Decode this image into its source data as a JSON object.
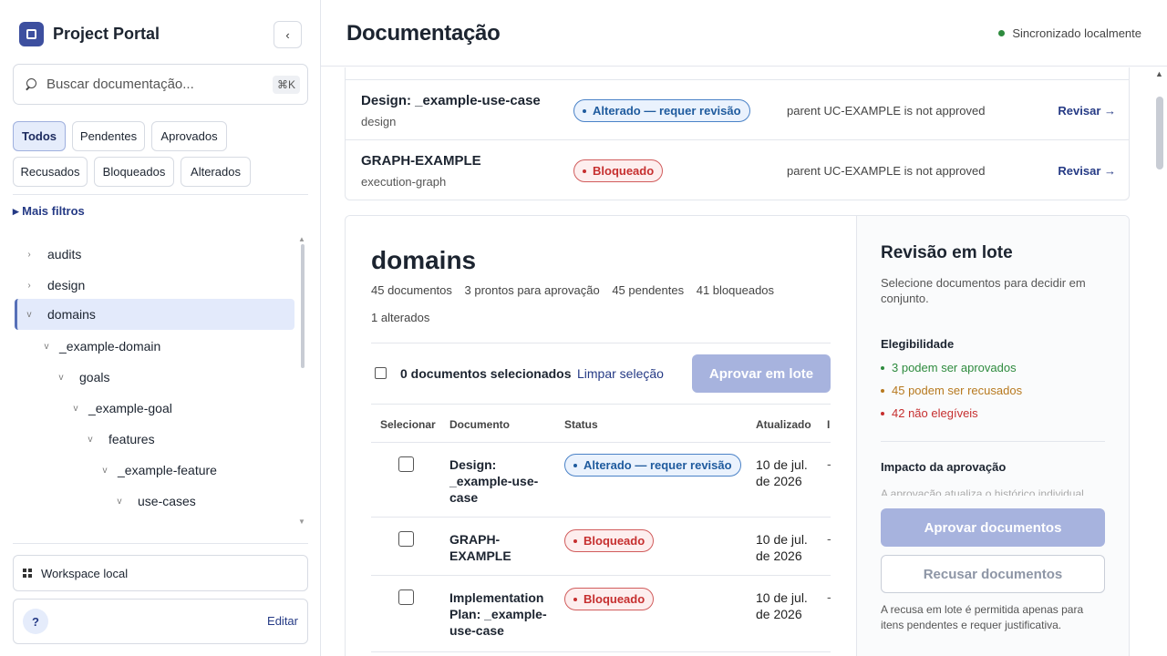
{
  "brand": {
    "title": "Project Portal",
    "collapse_icon": "‹"
  },
  "search": {
    "placeholder": "Buscar documentação...",
    "shortcut": "⌘K"
  },
  "filters": [
    {
      "label": "Todos",
      "active": true
    },
    {
      "label": "Pendentes"
    },
    {
      "label": "Aprovados"
    },
    {
      "label": "Recusados"
    },
    {
      "label": "Bloqueados"
    },
    {
      "label": "Alterados"
    }
  ],
  "more_filters": "▸ Mais filtros",
  "tree": [
    {
      "label": "audits",
      "chev": "›"
    },
    {
      "label": "design",
      "chev": "›"
    },
    {
      "label": "domains",
      "chev": "v",
      "selected": true
    },
    {
      "label": "_example-domain",
      "chev": "v"
    },
    {
      "label": "goals",
      "chev": "v"
    },
    {
      "label": "_example-goal",
      "chev": "v"
    },
    {
      "label": "features",
      "chev": "v"
    },
    {
      "label": "_example-feature",
      "chev": "v"
    },
    {
      "label": "use-cases",
      "chev": "v"
    }
  ],
  "workspace": "Workspace local",
  "help": {
    "icon": "?",
    "edit": "Editar"
  },
  "header": {
    "title": "Documentação",
    "sync": "Sincronizado localmente"
  },
  "top_rows": [
    {
      "title": "Design: _example-use-case",
      "sub": "design",
      "status": "Alterado — requer revisão",
      "status_type": "changed",
      "reason": "parent UC-EXAMPLE is not approved",
      "action": "Revisar →"
    },
    {
      "title": "GRAPH-EXAMPLE",
      "sub": "execution-graph",
      "status": "Bloqueado",
      "status_type": "blocked",
      "reason": "parent UC-EXAMPLE is not approved",
      "action": "Revisar →"
    }
  ],
  "domain": {
    "title": "domains",
    "stats": [
      "45 documentos",
      "3 prontos para aprovação",
      "45 pendentes",
      "41 bloqueados"
    ],
    "changed": "1 alterados",
    "selected": "0 documentos selecionados",
    "clear": "Limpar seleção",
    "approve_batch": "Aprovar em lote"
  },
  "table": {
    "headers": [
      "Selecionar",
      "Documento",
      "Status",
      "Atualizado",
      "I"
    ],
    "rows": [
      {
        "doc": "Design: _example-use-case",
        "status": "Alterado — requer revisão",
        "status_type": "changed",
        "date": "10 de jul. de 2026",
        "extra": "-"
      },
      {
        "doc": "GRAPH-EXAMPLE",
        "status": "Bloqueado",
        "status_type": "blocked",
        "date": "10 de jul. de 2026",
        "extra": "-"
      },
      {
        "doc": "Implementation Plan: _example-use-case",
        "status": "Bloqueado",
        "status_type": "blocked",
        "date": "10 de jul. de 2026",
        "extra": "-"
      }
    ]
  },
  "review": {
    "title": "Revisão em lote",
    "desc": "Selecione documentos para decidir em conjunto.",
    "eligibility_title": "Elegibilidade",
    "eligibility": [
      {
        "text": "3 podem ser aprovados",
        "color": "#2e8b3e"
      },
      {
        "text": "45 podem ser recusados",
        "color": "#b7791f"
      },
      {
        "text": "42 não elegíveis",
        "color": "#c62f2f"
      }
    ],
    "impact_title": "Impacto da aprovação",
    "impact_text": "A aprovação atualiza o histórico individual",
    "approve": "Aprovar documentos",
    "reject": "Recusar documentos",
    "note": "A recusa em lote é permitida apenas para itens pendentes e requer justificativa."
  },
  "colors": {
    "accent": "#3d4f9f",
    "link": "#253a85",
    "disabled_button": "#a7b3de"
  }
}
